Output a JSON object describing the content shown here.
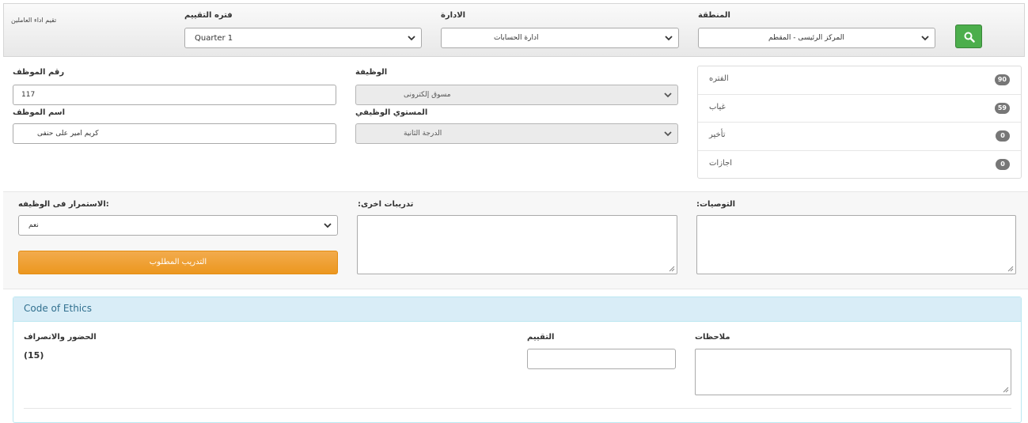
{
  "header": {
    "page_title": "تقيم اداء العاملين",
    "period_label": "فتره التقييم",
    "period_value": "Quarter 1",
    "department_label": "الادارة",
    "department_value": "ادارة الحسابات",
    "region_label": "المنطقة",
    "region_value": "المركز الرئيسى - المقطم",
    "search_icon": "search-icon"
  },
  "employee": {
    "number_label": "رقم الموظف",
    "number_value": "117",
    "job_label": "الوظيفة",
    "job_value": "مسوق إلكترونى",
    "name_label": "اسم الموظف",
    "name_value": "كريم امير على حنفى",
    "level_label": "المستوي الوظيفي",
    "level_value": "الدرجة الثانية"
  },
  "stats": [
    {
      "label": "الفتره",
      "count": "90"
    },
    {
      "label": "غياب",
      "count": "59"
    },
    {
      "label": "تأخير",
      "count": "0"
    },
    {
      "label": "اجازات",
      "count": "0"
    }
  ],
  "evaluation": {
    "continuity_label": ":الاستمرار فى الوظيفه",
    "continuity_value": "نعم",
    "training_button": "التدريب المطلوب",
    "other_training_label": "تدريبات اخرى:",
    "recommendations_label": "التوصيات:"
  },
  "ethics": {
    "title": "Code of Ethics",
    "attendance_label": "الحضور والانصراف",
    "attendance_score": "(15)",
    "rating_label": "التقييم",
    "notes_label": "ملاحظات"
  },
  "colors": {
    "search_button": "#4cae4c",
    "training_button": "#f0a035",
    "panel_header": "#d9edf7",
    "panel_title": "#31708f",
    "badge": "#777777"
  }
}
